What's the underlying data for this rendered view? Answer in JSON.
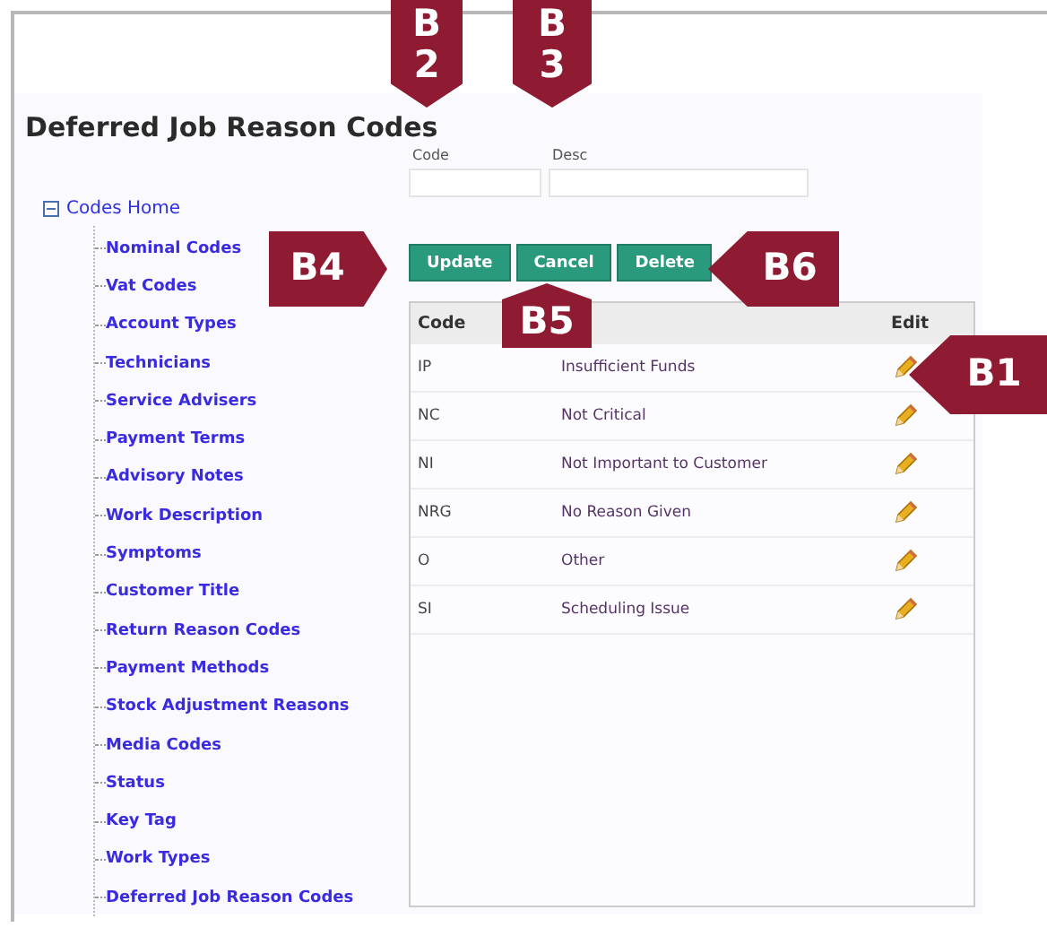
{
  "page": {
    "title": "Deferred Job Reason Codes"
  },
  "tree": {
    "label": "Codes Home",
    "expanded": true,
    "children": [
      {
        "label": "Nominal Codes"
      },
      {
        "label": "Vat Codes"
      },
      {
        "label": "Account Types"
      },
      {
        "label": "Technicians"
      },
      {
        "label": "Service Advisers"
      },
      {
        "label": "Payment Terms"
      },
      {
        "label": "Advisory Notes"
      },
      {
        "label": "Work Description"
      },
      {
        "label": "Symptoms"
      },
      {
        "label": "Customer Title"
      },
      {
        "label": "Return Reason Codes"
      },
      {
        "label": "Payment Methods"
      },
      {
        "label": "Stock Adjustment Reasons"
      },
      {
        "label": "Media Codes"
      },
      {
        "label": "Status"
      },
      {
        "label": "Key Tag"
      },
      {
        "label": "Work Types"
      },
      {
        "label": "Deferred Job Reason Codes"
      }
    ]
  },
  "form": {
    "fields": [
      {
        "label": "Code"
      },
      {
        "label": "Desc"
      }
    ],
    "buttons": [
      "Update",
      "Cancel",
      "Delete"
    ]
  },
  "table": {
    "columns": [
      {
        "label": "Code"
      },
      {},
      {
        "label": "Edit"
      }
    ],
    "rows": [
      {
        "code": "IP",
        "desc": "Insufficient Funds"
      },
      {
        "code": "NC",
        "desc": "Not Critical"
      },
      {
        "code": "NI",
        "desc": "Not Important to Customer"
      },
      {
        "code": "NRG",
        "desc": "No Reason Given"
      },
      {
        "code": "O",
        "desc": "Other"
      },
      {
        "code": "SI",
        "desc": "Scheduling Issue"
      }
    ]
  },
  "callouts": [
    {
      "label": "B1",
      "kind": "left"
    },
    {
      "label": "B2",
      "kind": "down"
    },
    {
      "label": "B3",
      "kind": "down"
    },
    {
      "label": "B4",
      "kind": "right"
    },
    {
      "label": "B5",
      "kind": "up"
    },
    {
      "label": "B6",
      "kind": "left"
    }
  ]
}
